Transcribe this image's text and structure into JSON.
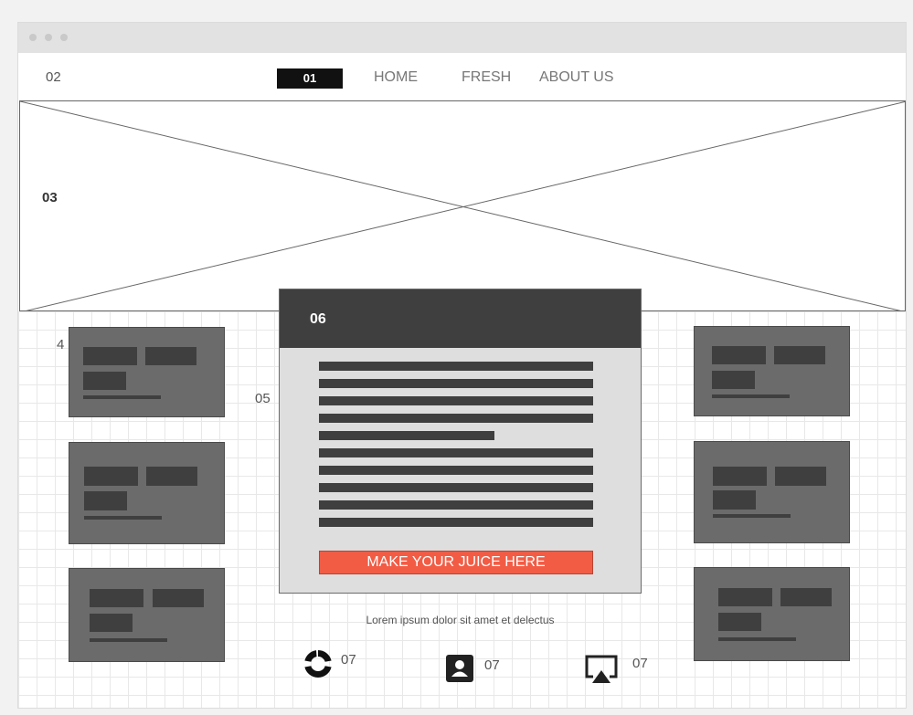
{
  "navbar": {
    "logo_label": "02",
    "active_label": "01",
    "links": [
      "HOME",
      "FRESH",
      "ABOUT US"
    ]
  },
  "hero": {
    "label": "03"
  },
  "annotations": {
    "cards_label": "4",
    "modal_side_label": "05"
  },
  "modal": {
    "title": "06",
    "cta_label": "MAKE YOUR JUICE HERE"
  },
  "caption": "Lorem ipsum dolor sit amet et delectus",
  "icons": [
    {
      "name": "spinner-icon",
      "label": "07"
    },
    {
      "name": "contact-icon",
      "label": "07"
    },
    {
      "name": "airplay-icon",
      "label": "07"
    }
  ],
  "colors": {
    "accent": "#f25c45",
    "dark": "#3f3f3f",
    "card": "#6b6b6b"
  }
}
